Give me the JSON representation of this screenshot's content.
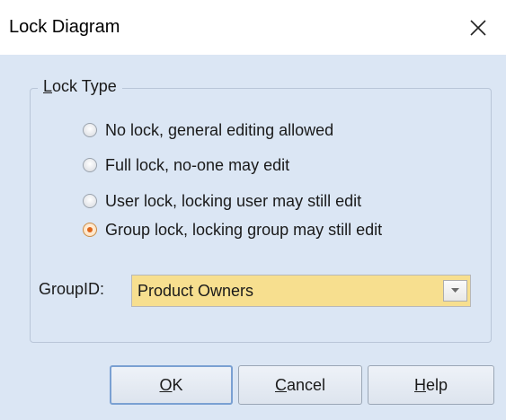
{
  "window": {
    "title": "Lock Diagram",
    "close_icon": "close-icon"
  },
  "lock_type": {
    "legend": "Lock Type",
    "options": [
      {
        "label": "No lock, general editing allowed",
        "selected": false
      },
      {
        "label": "Full lock, no-one may edit",
        "selected": false
      },
      {
        "label": "User lock, locking user may still edit",
        "selected": false
      },
      {
        "label": "Group lock, locking group may still edit",
        "selected": true
      }
    ]
  },
  "group": {
    "label": "GroupID:",
    "value": "Product Owners"
  },
  "buttons": {
    "ok": "OK",
    "cancel": "Cancel",
    "help": "Help"
  },
  "colors": {
    "dialog_bg": "#dbe6f4",
    "select_highlight": "#f7df8f",
    "radio_selected": "#e0661a"
  }
}
